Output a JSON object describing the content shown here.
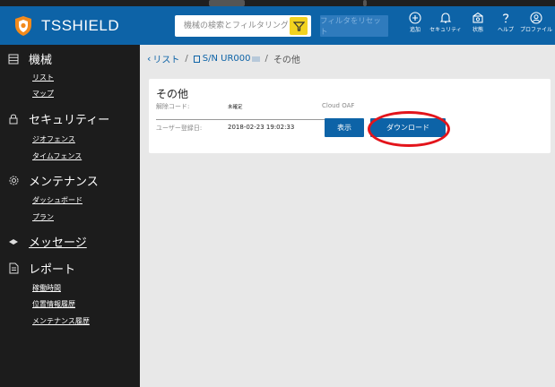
{
  "header": {
    "brand": "TSSHIELD",
    "search_placeholder": "機械の検索とフィルタリング",
    "reset_label": "フィルタをリセット",
    "icons": [
      {
        "name": "add-icon",
        "label": "追加"
      },
      {
        "name": "bell-icon",
        "label": "セキュリティ"
      },
      {
        "name": "status-icon",
        "label": "状態"
      },
      {
        "name": "help-icon",
        "label": "ヘルプ"
      },
      {
        "name": "profile-icon",
        "label": "プロファイル"
      }
    ]
  },
  "sidebar": {
    "machines": {
      "label": "機械",
      "items": [
        "リスト",
        "マップ"
      ]
    },
    "security": {
      "label": "セキュリティー",
      "items": [
        "ジオフェンス",
        "タイムフェンス"
      ]
    },
    "maintenance": {
      "label": "メンテナンス",
      "items": [
        "ダッシュボード",
        "プラン"
      ]
    },
    "messages": {
      "label": "メッセージ"
    },
    "reports": {
      "label": "レポート",
      "items": [
        "稼働時間",
        "位置情報履歴",
        "メンテナンス履歴"
      ]
    }
  },
  "breadcrumb": {
    "back": "リスト",
    "sep": "/",
    "serial": "S/N UR000",
    "current": "その他"
  },
  "card": {
    "title": "その他",
    "unlock_label": "解除コード:",
    "unlock_value": "未確定",
    "cloud_label": "Cloud OAF",
    "registered_label": "ユーザー登録日:",
    "registered_value": "2018-02-23 19:02:33",
    "show_label": "表示",
    "download_label": "ダウンロード"
  },
  "colors": {
    "header_blue": "#0d63a7",
    "sidebar_dark": "#1c1c1c",
    "filter_yellow": "#f2d21f",
    "highlight_red": "#e3141b"
  }
}
